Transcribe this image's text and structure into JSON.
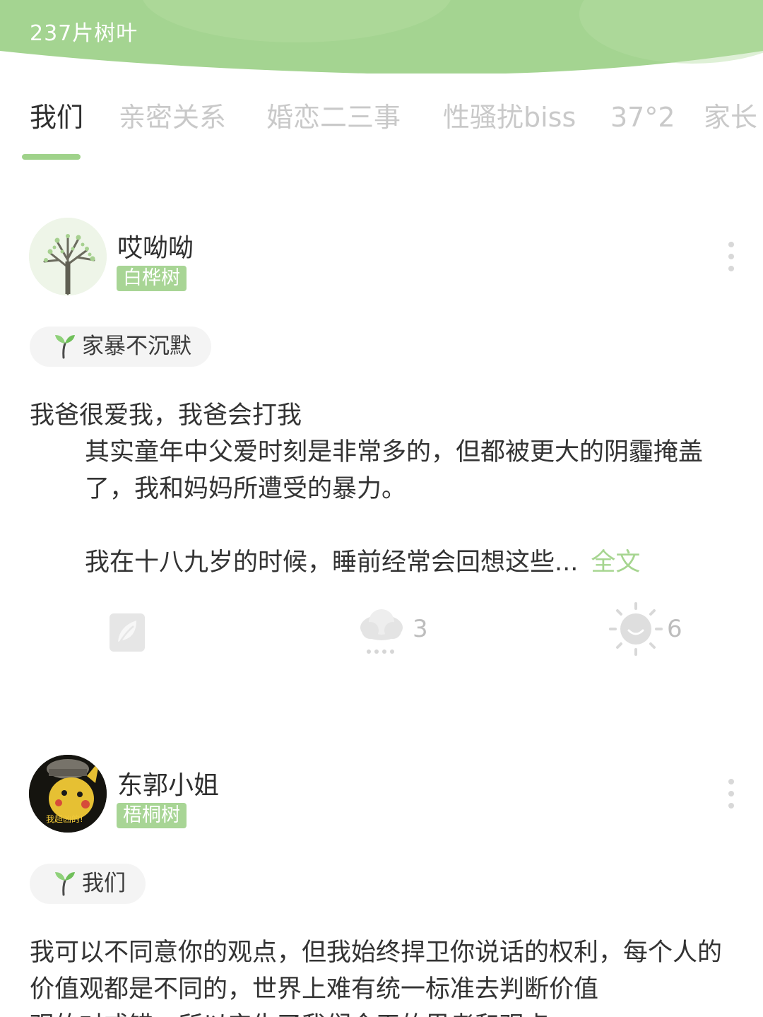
{
  "header": {
    "leaf_count": "237片树叶",
    "color": "#a4d491"
  },
  "tabs": [
    {
      "label": "我们",
      "active": true
    },
    {
      "label": "亲密关系"
    },
    {
      "label": "婚恋二三事"
    },
    {
      "label": "性骚扰biss"
    },
    {
      "label": "37°2"
    },
    {
      "label": "家长"
    }
  ],
  "colors": {
    "accent": "#a6d590",
    "badge": "#a8d595",
    "muted": "#bdbdbd"
  },
  "posts": [
    {
      "username": "哎呦呦",
      "tree": "白桦树",
      "avatar": "tree-avatar",
      "topic": "家暴不沉默",
      "lines": [
        "我爸很爱我，我爸会打我",
        "其实童年中父爱时刻是非常多的，但都被更大的阴霾掩盖了，我和妈妈所遭受的暴力。",
        "我在十八九岁的时候，睡前经常会回想这些..."
      ],
      "full_text_link": "全文",
      "actions": {
        "leaf_icon": "leaf-card-icon",
        "rain_icon": "rain-cloud-icon",
        "rain_count": "3",
        "sun_icon": "sun-icon",
        "sun_count": "6"
      }
    },
    {
      "username": "东郭小姐",
      "tree": "梧桐树",
      "avatar": "pikachu-avatar",
      "avatar_caption": "我超凶的!",
      "topic": "我们",
      "lines": [
        "我可以不同意你的观点，但我始终捍卫你说话的权利，每个人的价值观都是不同的，世界上难有统一标准去判断价值",
        "观的对或错，所以产生了我们今天的思考和观点"
      ]
    }
  ]
}
